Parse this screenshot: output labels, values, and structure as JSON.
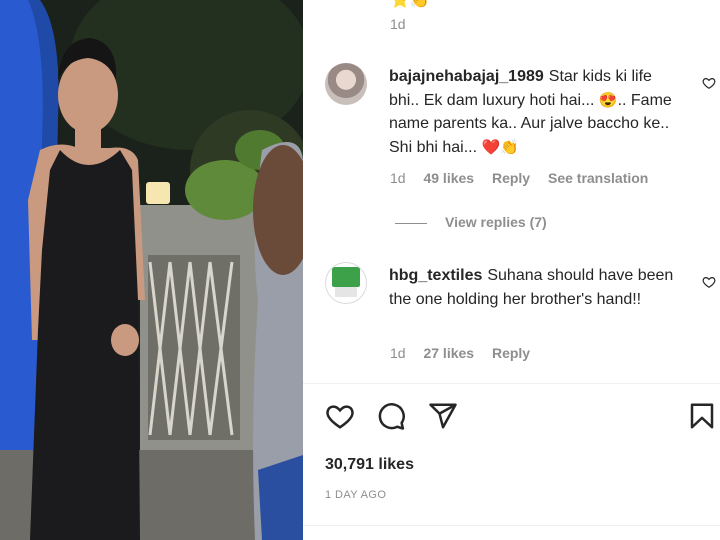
{
  "post": {
    "top_emojis": "⭐👏",
    "top_time": "1d"
  },
  "comments": [
    {
      "username": "bajajnehabajaj_1989",
      "text": "Star kids ki life bhi.. Ek dam luxury hoti hai... ",
      "emoji1": "😍",
      "text2": ".. Fame name parents ka.. Aur jalve baccho ke.. Shi bhi hai... ",
      "emoji2": "❤️👏",
      "time": "1d",
      "likes": "49 likes",
      "reply": "Reply",
      "translate": "See translation",
      "view_replies": "View replies (7)"
    },
    {
      "username": "hbg_textiles",
      "text": "Suhana should have been the one holding her brother's hand!!",
      "time": "1d",
      "likes": "27 likes",
      "reply": "Reply"
    }
  ],
  "actions": {
    "like_icon": "heart-icon",
    "comment_icon": "comment-icon",
    "share_icon": "paper-plane-icon",
    "save_icon": "bookmark-icon"
  },
  "likes_count": "30,791 likes",
  "posted": "1 DAY AGO",
  "colors": {
    "text": "#262626",
    "secondary": "#8e8e8e",
    "divider": "#efefef",
    "heart_red": "#e0245e"
  }
}
